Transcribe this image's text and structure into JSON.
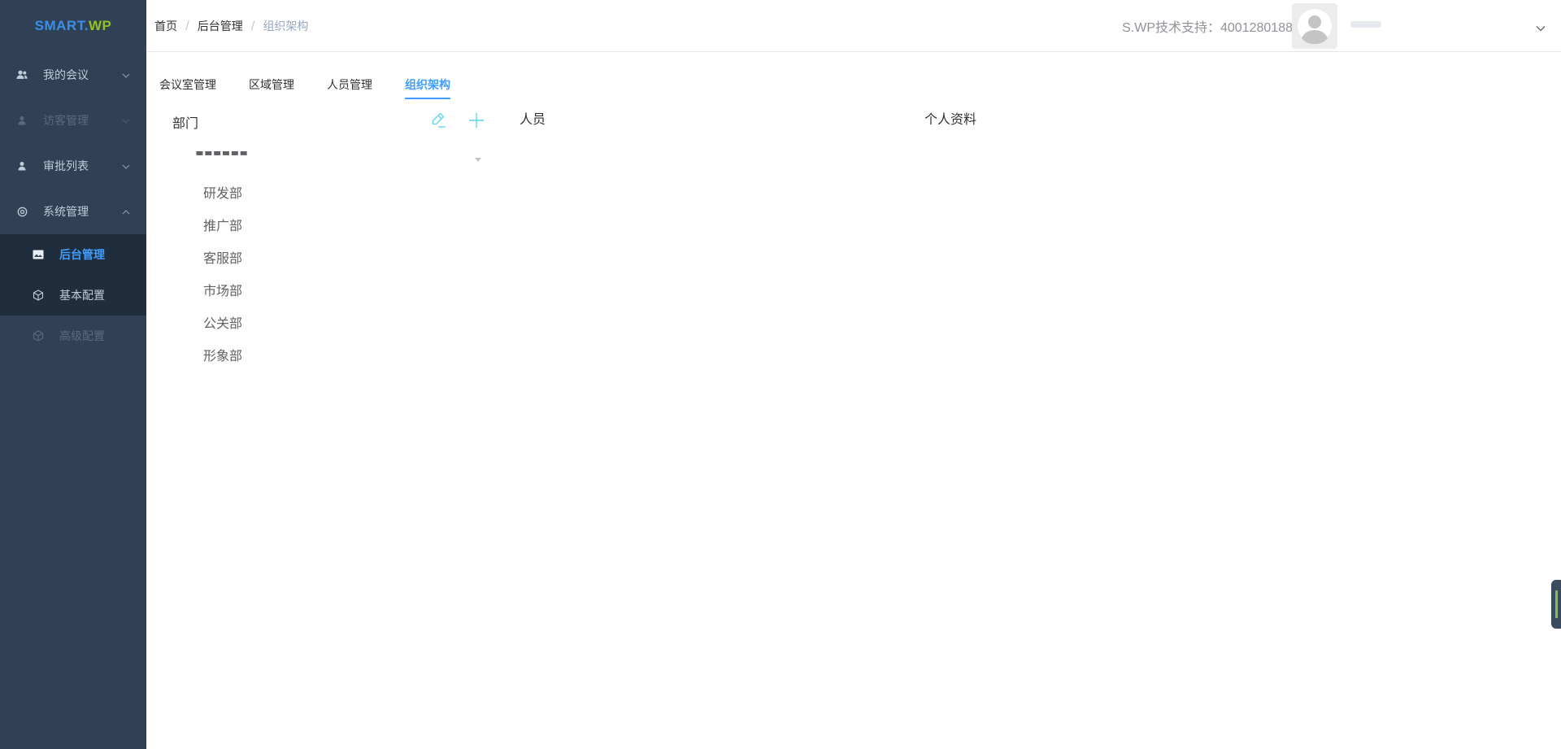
{
  "brand": {
    "part1": "SMART.",
    "part2": "WP"
  },
  "sidebar": {
    "items": [
      {
        "label": "我的会议",
        "icon": "users-icon",
        "state": "collapsed"
      },
      {
        "label": "访客管理",
        "icon": "user-icon",
        "state": "disabled"
      },
      {
        "label": "审批列表",
        "icon": "user-icon",
        "state": "collapsed"
      },
      {
        "label": "系统管理",
        "icon": "settings-icon",
        "state": "expanded"
      }
    ],
    "subitems": [
      {
        "label": "后台管理",
        "icon": "image-icon",
        "state": "active"
      },
      {
        "label": "基本配置",
        "icon": "cube-icon",
        "state": "normal"
      },
      {
        "label": "高级配置",
        "icon": "cube-icon",
        "state": "disabled"
      }
    ]
  },
  "header": {
    "breadcrumb": [
      "首页",
      "后台管理",
      "组织架构"
    ],
    "separator": "/",
    "support_text": "S.WP技术支持：4001280188"
  },
  "tabs": [
    {
      "label": "会议室管理",
      "active": false
    },
    {
      "label": "区域管理",
      "active": false
    },
    {
      "label": "人员管理",
      "active": false
    },
    {
      "label": "组织架构",
      "active": true
    }
  ],
  "panels": {
    "department_title": "部门",
    "people_title": "人员",
    "profile_title": "个人资料"
  },
  "departments": [
    "研发部",
    "推广部",
    "客服部",
    "市场部",
    "公关部",
    "形象部"
  ],
  "colors": {
    "sidebar_bg": "#304156",
    "submenu_bg": "#1f2d3d",
    "accent": "#409eff",
    "action_icon": "#5cd6e8"
  }
}
